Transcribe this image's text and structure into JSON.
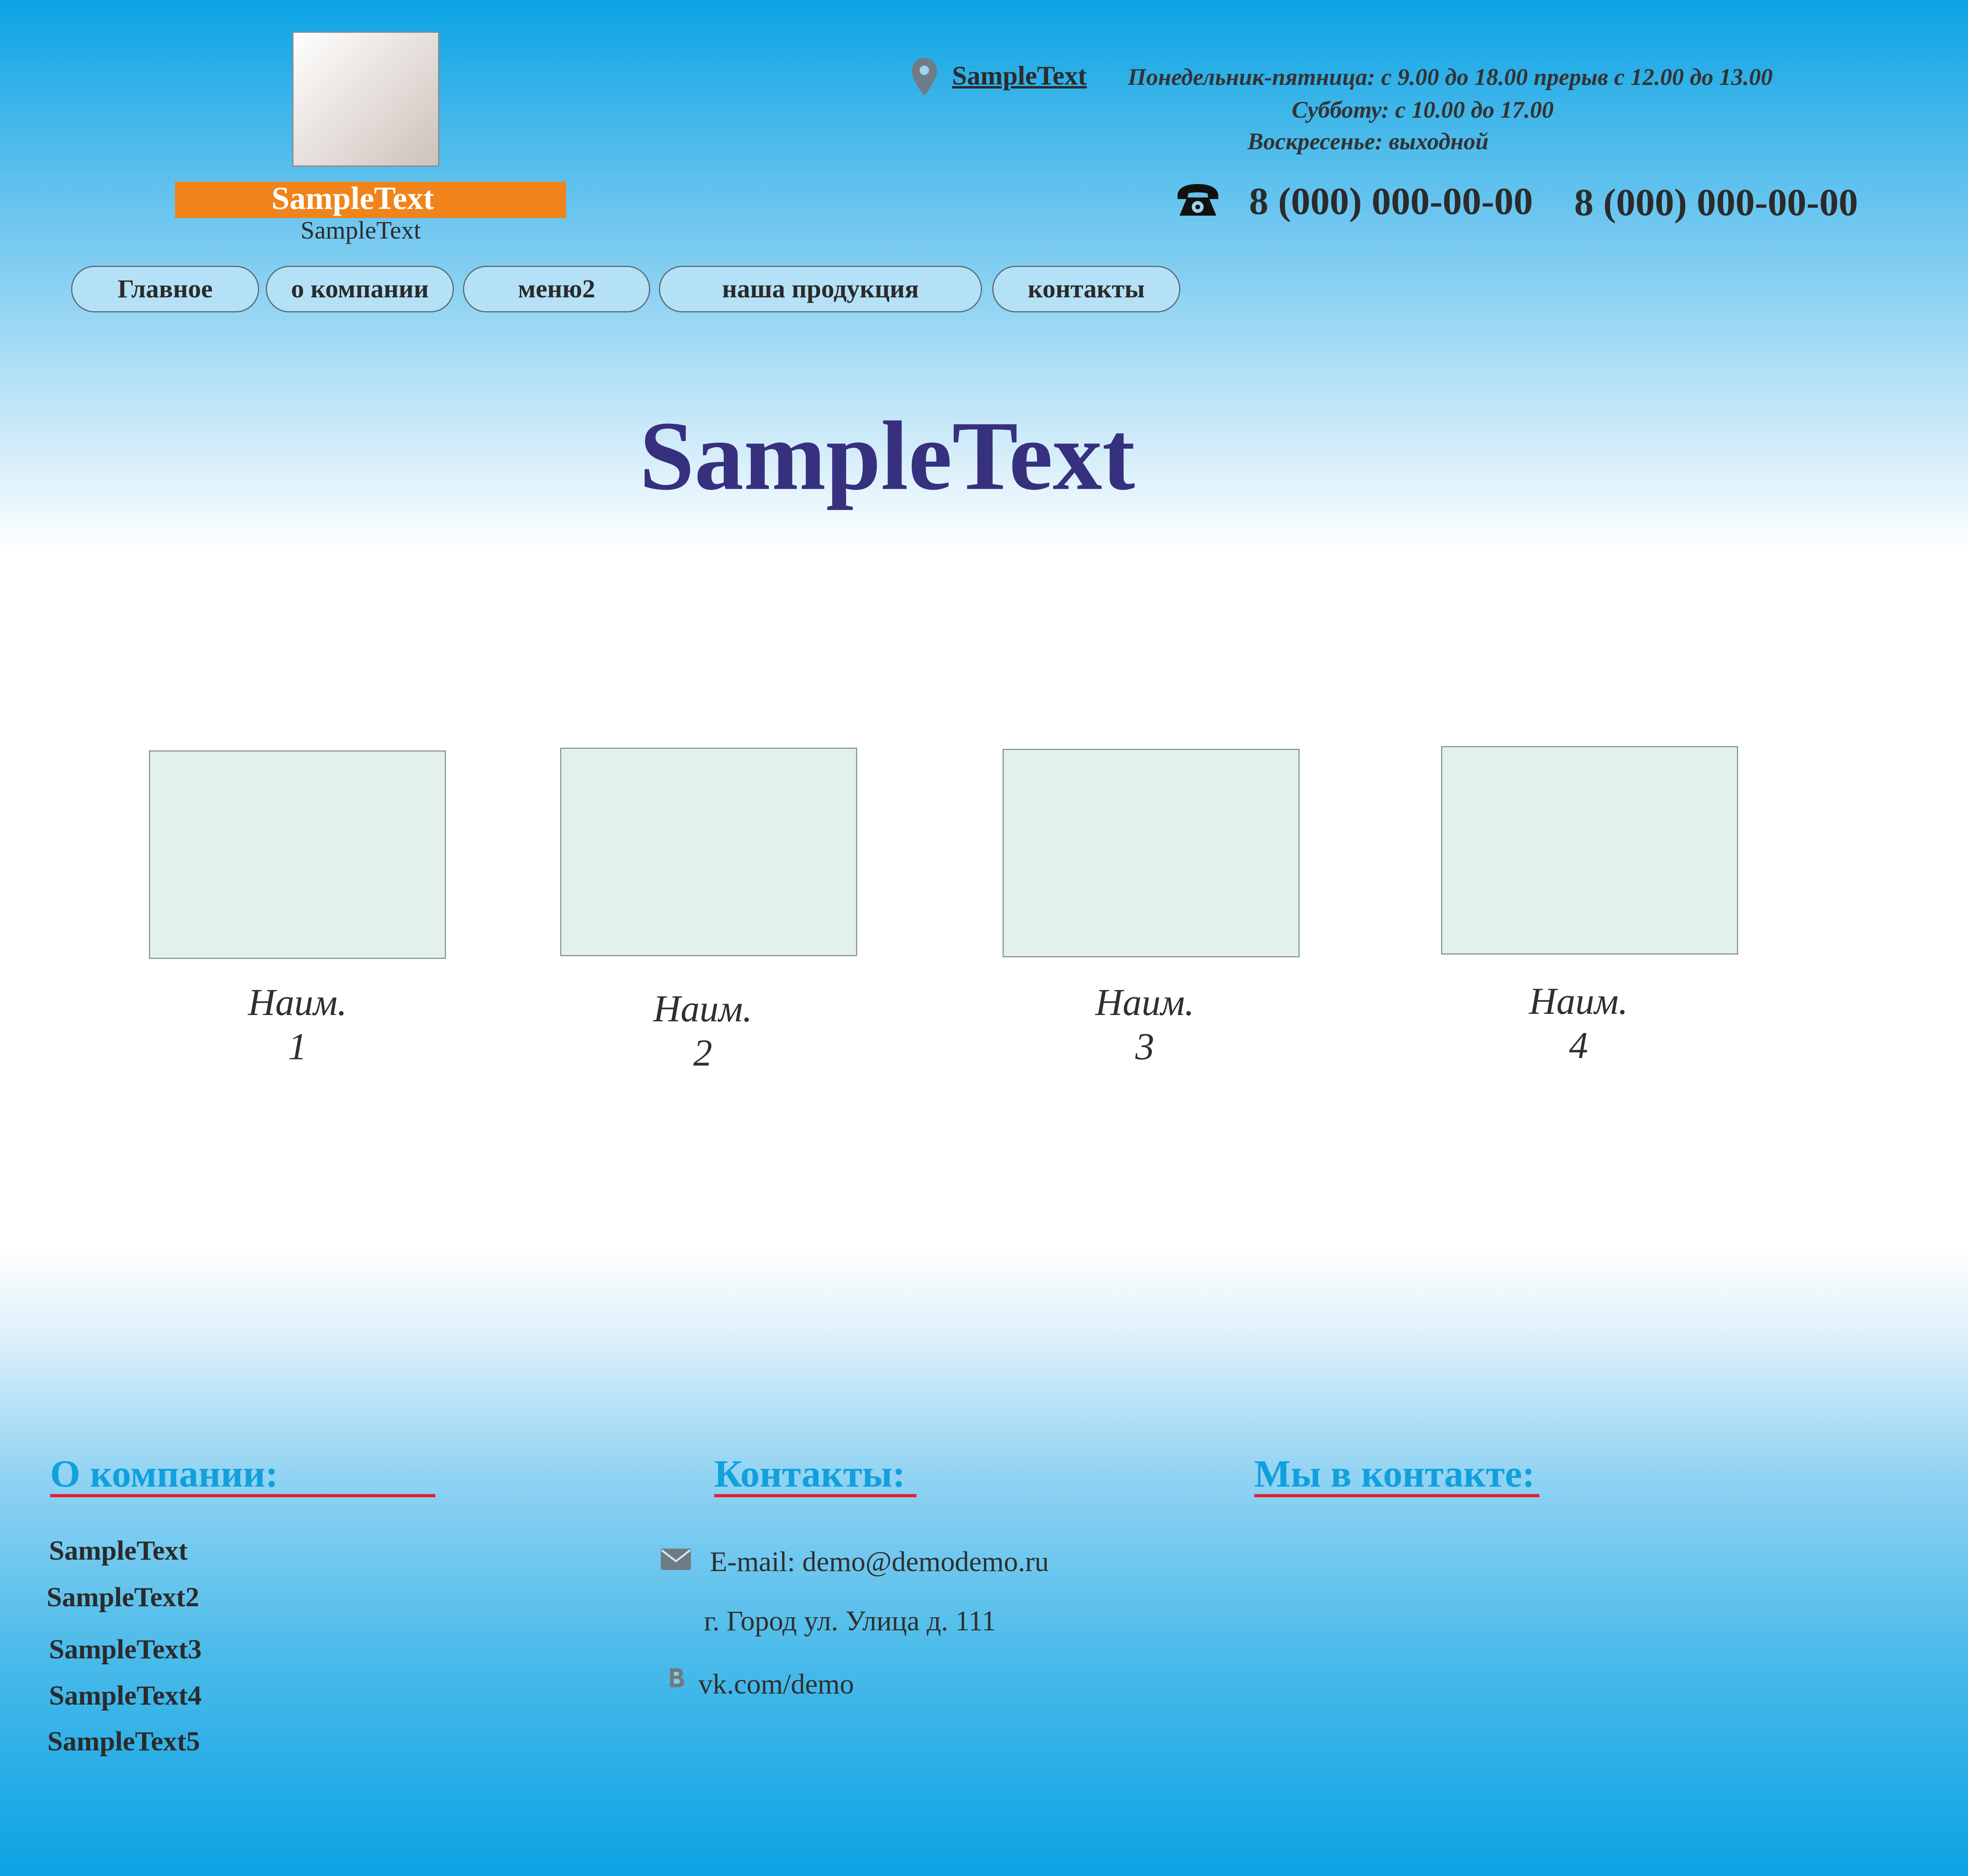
{
  "header": {
    "logo_title": "SampleText",
    "logo_subtitle": "SampleText",
    "address_link": "SampleText",
    "hours": [
      "Понедельник-пятница: с 9.00 до 18.00 прерыв с 12.00 до 13.00",
      "Субботу: с 10.00 до 17.00",
      "Воскресенье:  выходной"
    ],
    "phones": [
      "8 (000) 000-00-00",
      "8 (000) 000-00-00"
    ],
    "logo_colors": {
      "band": "#f0841a"
    }
  },
  "nav": {
    "items": [
      {
        "label": "Главное"
      },
      {
        "label": "о компании"
      },
      {
        "label": "меню2"
      },
      {
        "label": "наша продукция"
      },
      {
        "label": "контакты"
      }
    ]
  },
  "main": {
    "title": "SampleText",
    "products": [
      {
        "name": "Наим.",
        "number": "1"
      },
      {
        "name": "Наим.",
        "number": "2"
      },
      {
        "name": "Наим.",
        "number": "3"
      },
      {
        "name": "Наим.",
        "number": "4"
      }
    ]
  },
  "footer": {
    "about": {
      "heading": "О компании:",
      "items": [
        "SampleText",
        "SampleText2",
        "SampleText3",
        "SampleText4",
        "SampleText5"
      ]
    },
    "contacts": {
      "heading": "Контакты:",
      "email": "E-mail: demo@demodemo.ru",
      "address": "г. Город ул. Улица д. 111",
      "vk": "vk.com/demo"
    },
    "vk_section": {
      "heading": "Мы в контакте:"
    }
  },
  "colors": {
    "accent_blue": "#10a0de",
    "title_navy": "#37307e",
    "underline_red": "#e51e34",
    "nav_fill": "#b5e1f7"
  },
  "icons": [
    "location-pin-icon",
    "telephone-icon",
    "mail-icon",
    "vk-icon"
  ]
}
